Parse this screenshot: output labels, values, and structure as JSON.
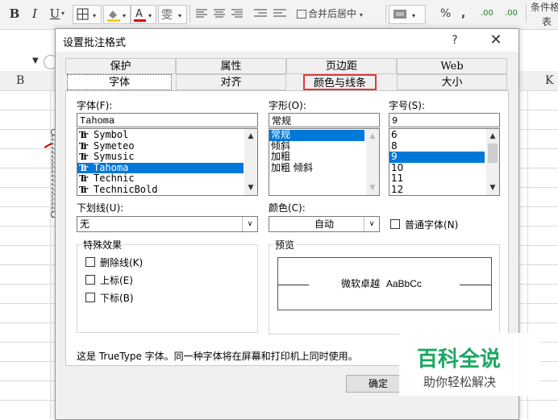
{
  "ribbon": {
    "bold": "B",
    "italic": "I",
    "underline": "U",
    "merge_center": "合并后居中",
    "percent": "%",
    "comma": ",",
    "dec_inc": ".00",
    "dec_dec": ".00",
    "cond_format": "条件格式",
    "table_partial": "表"
  },
  "sheet": {
    "columns": [
      "B",
      "K"
    ]
  },
  "dialog": {
    "title": "设置批注格式",
    "help": "?",
    "close": "✕",
    "tabs_row1": [
      "保护",
      "属性",
      "页边距",
      "Web"
    ],
    "tabs_row2": [
      "字体",
      "对齐",
      "颜色与线条",
      "大小"
    ],
    "font_label": "字体(F):",
    "font_value": "Tahoma",
    "font_list": [
      "Symbol",
      "Symeteo",
      "Symusic",
      "Tahoma",
      "Technic",
      "TechnicBold"
    ],
    "font_selected": "Tahoma",
    "style_label": "字形(O):",
    "style_value": "常规",
    "style_list": [
      "常规",
      "倾斜",
      "加粗",
      "加粗 倾斜"
    ],
    "style_selected": "常规",
    "size_label": "字号(S):",
    "size_value": "9",
    "size_list": [
      "6",
      "8",
      "9",
      "10",
      "11",
      "12"
    ],
    "size_selected": "9",
    "underline_label": "下划线(U):",
    "underline_value": "无",
    "color_label": "颜色(C):",
    "color_value": "自动",
    "normal_font_label": "普通字体(N)",
    "effects_title": "特殊效果",
    "strikethrough": "删除线(K)",
    "superscript": "上标(E)",
    "subscript": "下标(B)",
    "preview_title": "预览",
    "preview_text_cn": "微软卓越",
    "preview_text_en": "AaBbCc",
    "info_text": "这是 TrueType 字体。同一种字体将在屏幕和打印机上同时使用。",
    "ok_button": "确定"
  },
  "watermark": {
    "title": "百科全说",
    "subtitle": "助你轻松解决"
  },
  "colors": {
    "selection": "#0078d7",
    "highlight_border": "#e0393e",
    "watermark_green": "#1aa860"
  }
}
